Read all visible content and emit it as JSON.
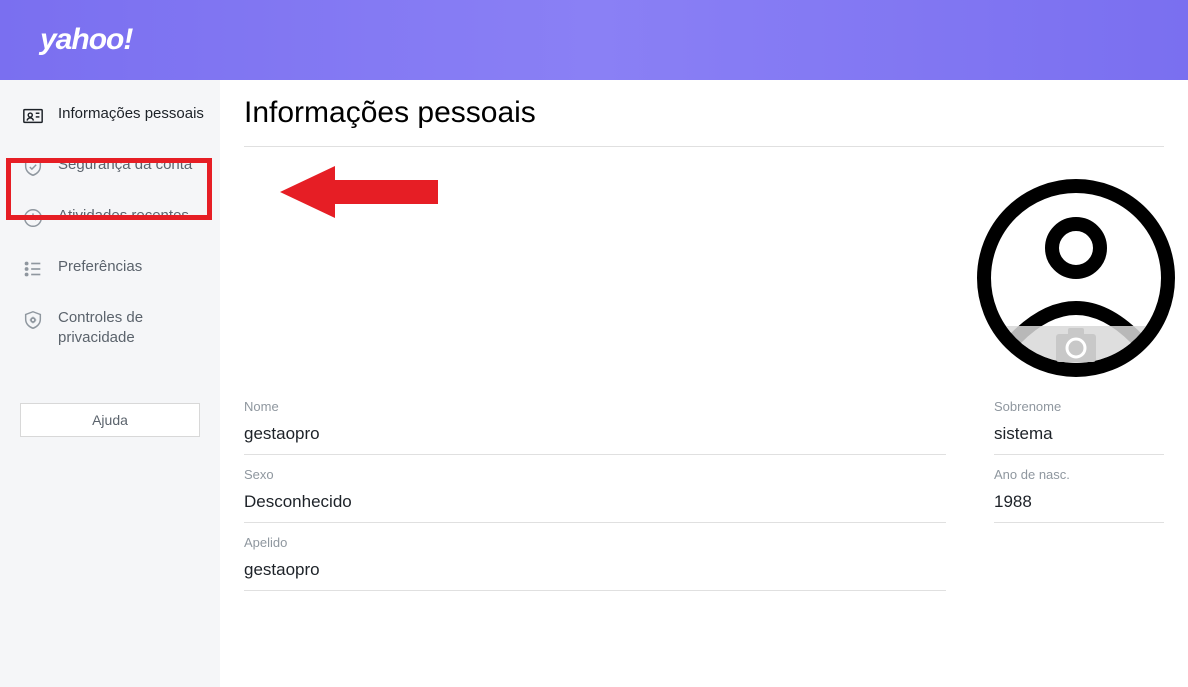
{
  "header": {
    "logo": "yahoo!"
  },
  "sidebar": {
    "items": [
      {
        "label": "Informações pessoais"
      },
      {
        "label": "Segurança da conta"
      },
      {
        "label": "Atividades recentes"
      },
      {
        "label": "Preferências"
      },
      {
        "label": "Controles de privacidade"
      }
    ],
    "help": "Ajuda"
  },
  "main": {
    "title": "Informações pessoais",
    "fields": {
      "name_label": "Nome",
      "name_value": "gestaopro",
      "surname_label": "Sobrenome",
      "surname_value": "sistema",
      "gender_label": "Sexo",
      "gender_value": "Desconhecido",
      "birthyear_label": "Ano de nasc.",
      "birthyear_value": "1988",
      "nickname_label": "Apelido",
      "nickname_value": "gestaopro"
    }
  }
}
